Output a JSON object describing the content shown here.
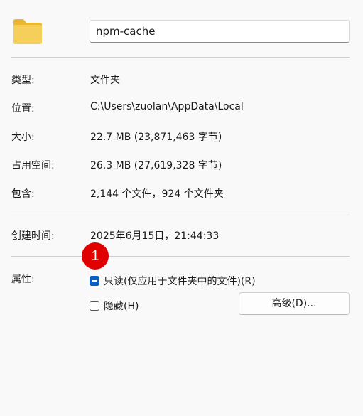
{
  "header": {
    "name_value": "npm-cache"
  },
  "rows": {
    "type": {
      "label": "类型:",
      "value": "文件夹"
    },
    "location": {
      "label": "位置:",
      "value": "C:\\Users\\zuolan\\AppData\\Local"
    },
    "size": {
      "label": "大小:",
      "value": "22.7 MB (23,871,463 字节)"
    },
    "disk": {
      "label": "占用空间:",
      "value": "26.3 MB (27,619,328 字节)"
    },
    "contains": {
      "label": "包含:",
      "value": "2,144 个文件，924 个文件夹"
    },
    "created": {
      "label": "创建时间:",
      "value": "2025年6月15日，21:44:33"
    }
  },
  "attributes": {
    "label": "属性:",
    "readonly": {
      "label": "只读(仅应用于文件夹中的文件)(R)",
      "state": "indeterminate"
    },
    "hidden": {
      "label": "隐藏(H)",
      "state": "unchecked"
    },
    "advanced_button": "高级(D)..."
  },
  "annotation": {
    "badge": "1",
    "color": "#e00000"
  },
  "icons": {
    "folder": "folder-icon"
  },
  "colors": {
    "accent": "#0a5fc2",
    "folder": "#f4c84a"
  }
}
